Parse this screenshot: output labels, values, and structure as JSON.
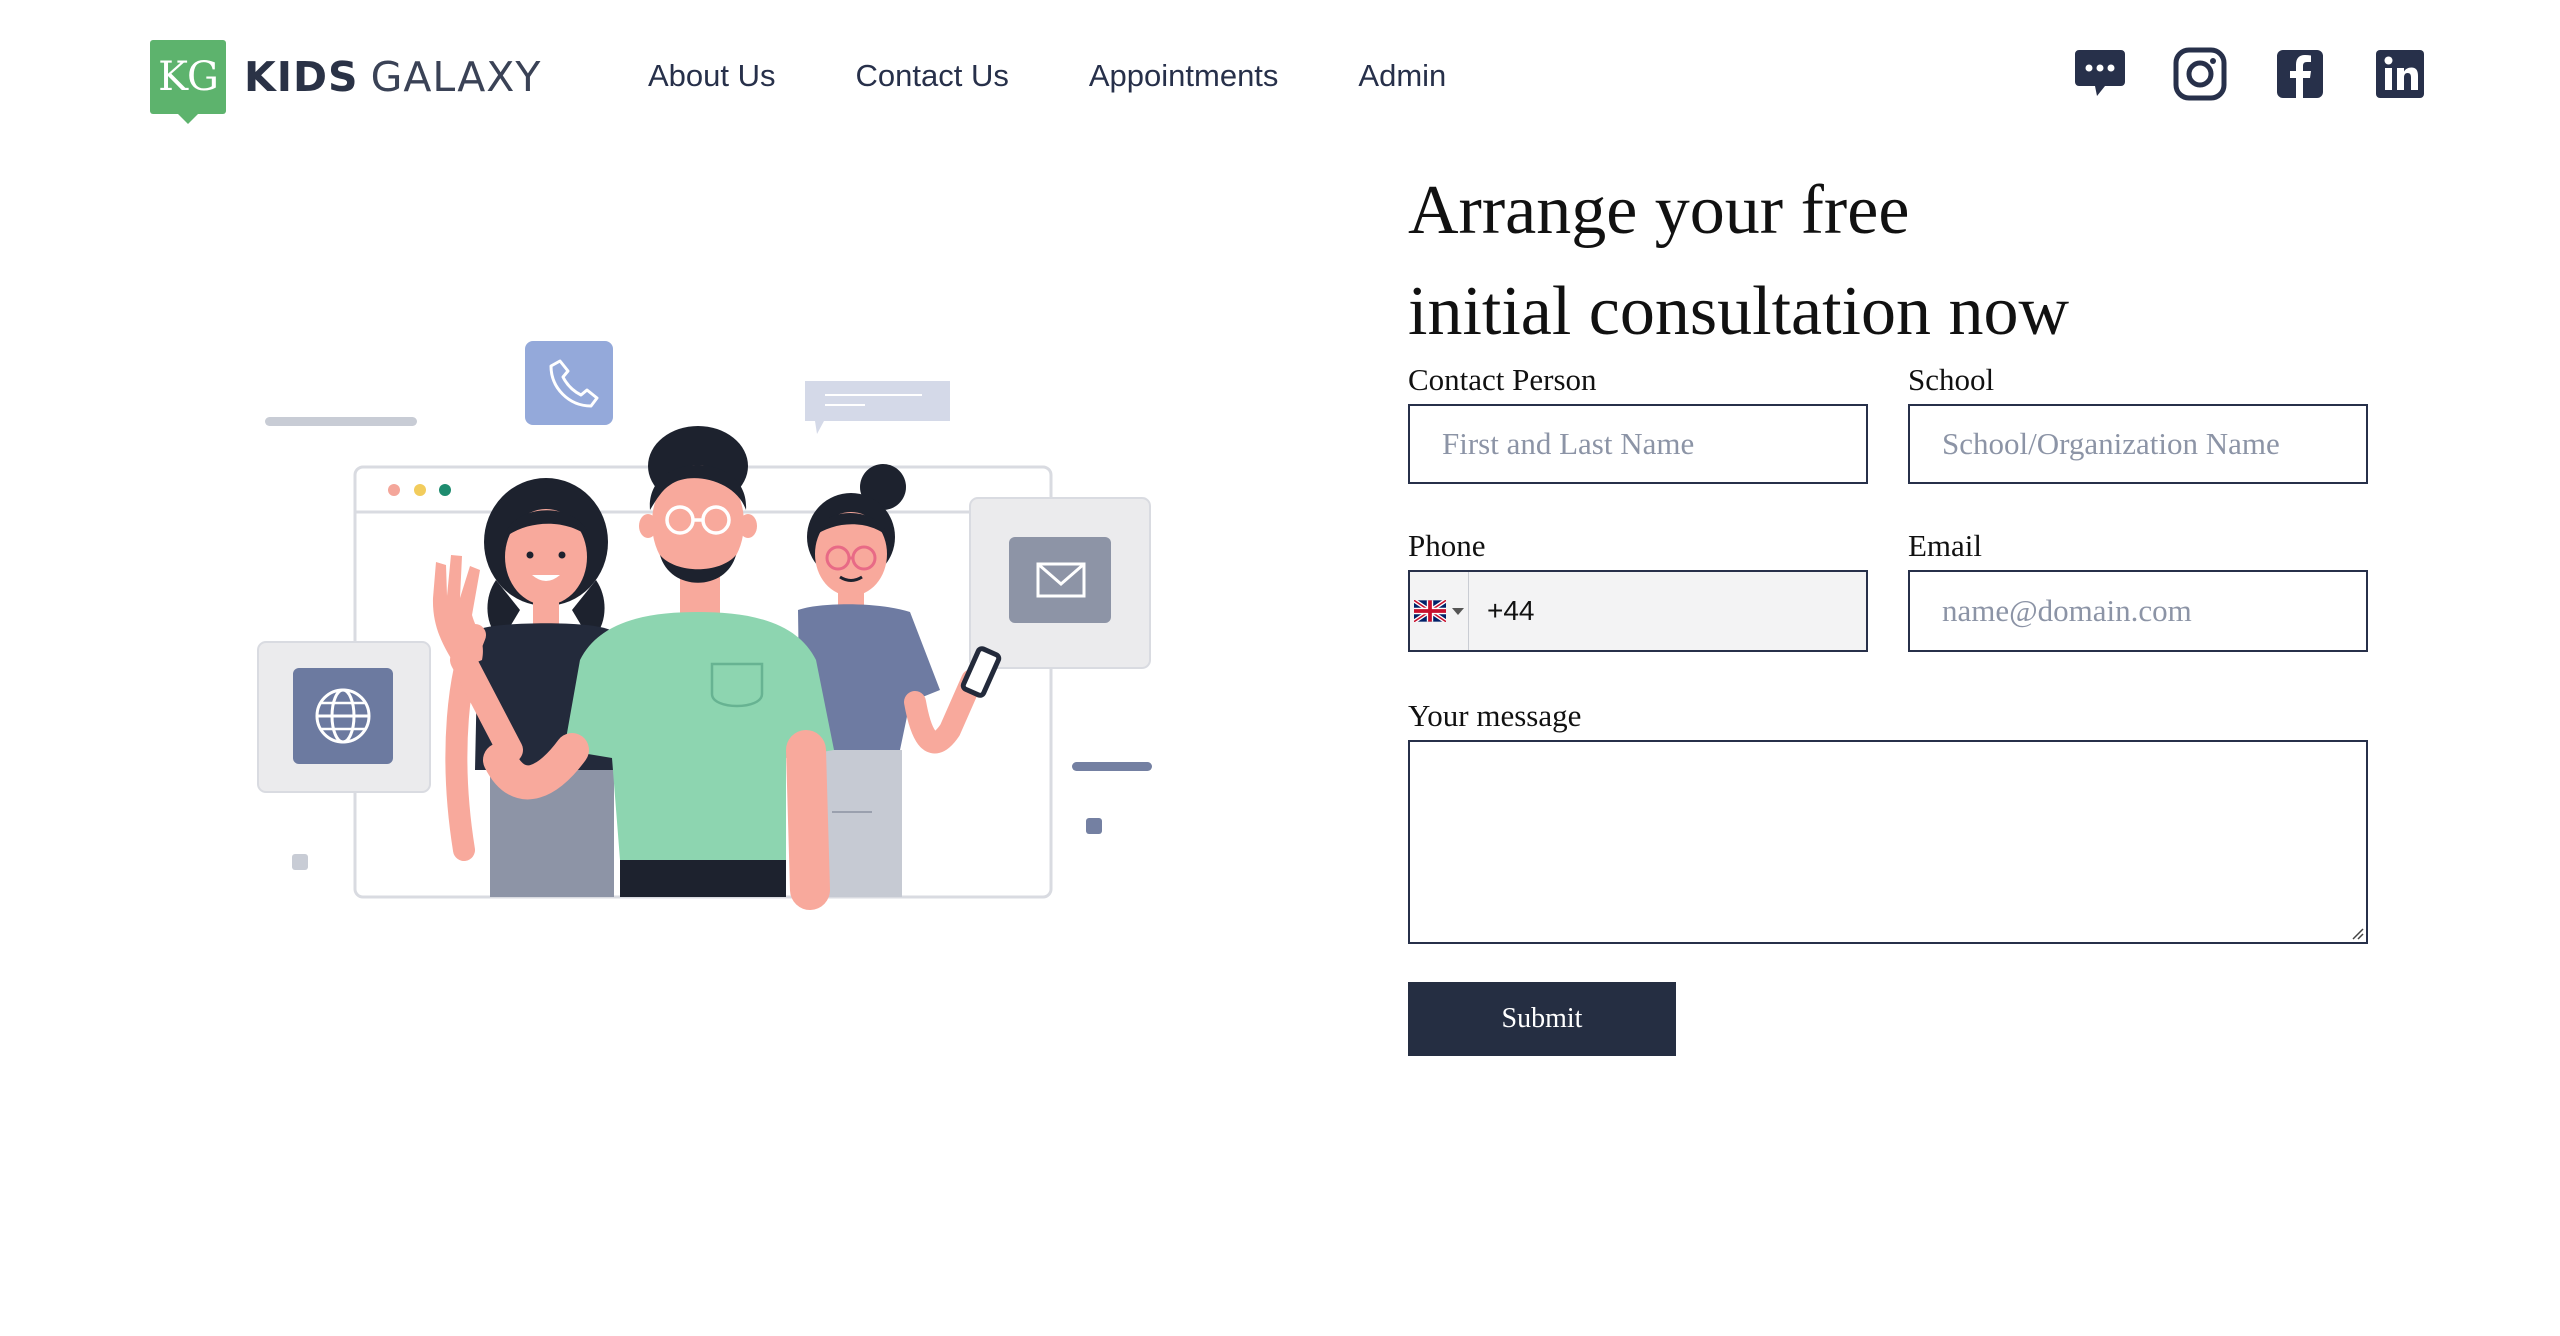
{
  "brand": {
    "badge": "KG",
    "name_bold": "KIDS",
    "name_light": "GALAXY",
    "color": "#5db36d"
  },
  "nav": {
    "items": [
      "About Us",
      "Contact Us",
      "Appointments",
      "Admin"
    ]
  },
  "socials": [
    "chat-icon",
    "instagram-icon",
    "facebook-icon",
    "linkedin-icon"
  ],
  "form": {
    "heading_line1": "Arrange your free",
    "heading_line2": "initial consultation now",
    "contact_label": "Contact Person",
    "contact_placeholder": "First and Last Name",
    "school_label": "School",
    "school_placeholder": "School/Organization Name",
    "phone_label": "Phone",
    "phone_value": "+44",
    "phone_country": "UK",
    "email_label": "Email",
    "email_placeholder": "name@domain.com",
    "message_label": "Your message",
    "message_value": "",
    "submit_label": "Submit"
  },
  "colors": {
    "navy": "#27304a",
    "button": "#252e42",
    "accent_green": "#5db36d",
    "shirt_green": "#8dd5b0"
  }
}
